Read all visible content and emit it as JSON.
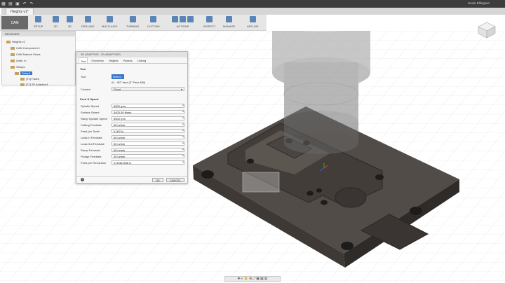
{
  "app": {
    "doc_tab": "Heights v1*",
    "user": "Kevin Ellingson"
  },
  "toolbar": {
    "cam": "CAM",
    "groups": [
      "SETUP",
      "2D",
      "3D",
      "DRILLING",
      "MULTI-AXIS",
      "TURNING",
      "CUTTING",
      "ACTIONS",
      "INSPECT",
      "MANAGE",
      "ADD-INS"
    ]
  },
  "browser": {
    "title": "BROWSER",
    "items": [
      "Heights v1",
      "CAM Component 1",
      "CAM Named Views",
      "Units: in",
      "Setups",
      "Setup1",
      "[T1] Face2",
      "[T1] 2D Adaptive1"
    ]
  },
  "dialog": {
    "title": "2D ADAPTIVE : 2D ADAPTIVE1",
    "tabs": [
      "Tool",
      "Geometry",
      "Heights",
      "Passes",
      "Linking"
    ],
    "tool_section": "Tool",
    "tool_label": "Tool",
    "select_button": "Select...",
    "tool_desc": "#1 - Ø2\" face (2\" Face Mill)",
    "coolant_label": "Coolant",
    "coolant_value": "Flood",
    "feed_section": "Feed & Speed",
    "fields": [
      {
        "label": "Spindle Speed",
        "value": "6500 rpm"
      },
      {
        "label": "Surface Speed",
        "value": "3403.39 ft/min"
      },
      {
        "label": "Ramp Spindle Speed",
        "value": "6500 rpm"
      },
      {
        "label": "Cutting Feedrate",
        "value": "65 in/min"
      },
      {
        "label": "Feed per Tooth",
        "value": "0.002 in"
      },
      {
        "label": "Lead-In Feedrate",
        "value": "65 in/min"
      },
      {
        "label": "Lead-Out Feedrate",
        "value": "65 in/min"
      },
      {
        "label": "Ramp Feedrate",
        "value": "65 in/min"
      },
      {
        "label": "Plunge Feedrate",
        "value": "30 in/min"
      },
      {
        "label": "Feed per Revolution",
        "value": "0.00461538 in"
      }
    ],
    "ok": "OK",
    "cancel": "CANCEL"
  }
}
